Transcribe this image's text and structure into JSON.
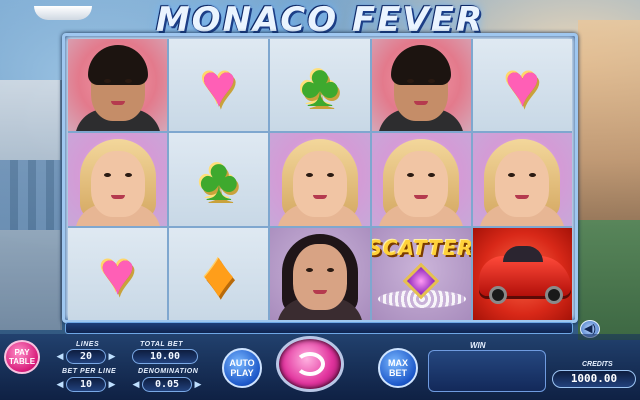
{
  "title": "MONACO FEVER",
  "reels": [
    [
      "man",
      "girl",
      "heart"
    ],
    [
      "heart",
      "club",
      "diamond"
    ],
    [
      "club",
      "girl",
      "dark-lady"
    ],
    [
      "man",
      "girl",
      "scatter"
    ],
    [
      "heart",
      "girl",
      "car"
    ]
  ],
  "symbols": {
    "scatter_text": "SCATTER",
    "heart_glyph": "♥",
    "club_glyph": "♣",
    "diamond_glyph": "♦"
  },
  "controls": {
    "paytable_label": "PAY TABLE",
    "lines_label": "LINES",
    "lines_value": "20",
    "total_bet_label": "TOTAL BET",
    "total_bet_value": "10.00",
    "bet_per_line_label": "BET PER LINE",
    "bet_per_line_value": "10",
    "denomination_label": "DENOMINATION",
    "denomination_value": "0.05",
    "autoplay_label": "AUTO PLAY",
    "maxbet_label": "MAX BET",
    "win_label": "WIN",
    "win_value": "",
    "credits_label": "CREDITS",
    "credits_value": "1000.00",
    "arrow_left": "◀",
    "arrow_right": "▶",
    "speaker_glyph": "◀)"
  },
  "colors": {
    "spin_button": "#e2349e",
    "frame_border": "#9fc7f0",
    "title_glow": "#6fb7ff"
  }
}
